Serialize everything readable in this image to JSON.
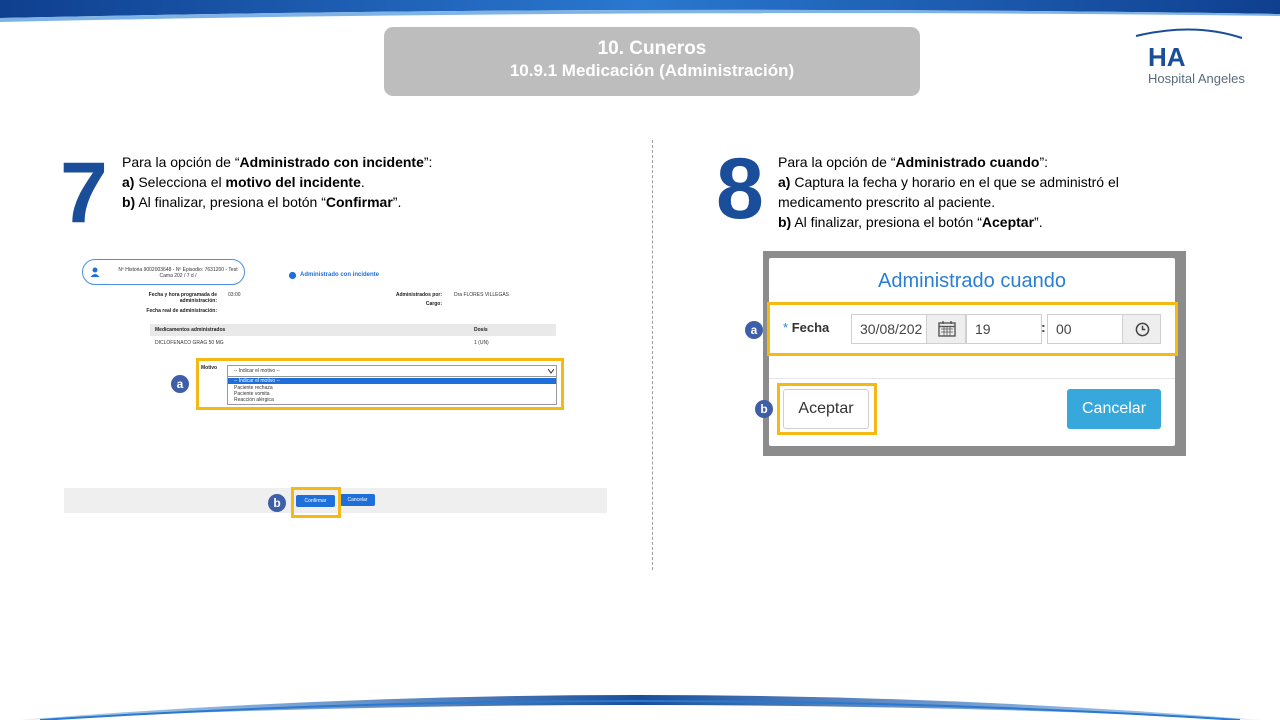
{
  "header": {
    "title_line1": "10. Cuneros",
    "title_line2": "10.9.1 Medicación (Administración)",
    "logo_text": "Hospital Angeles",
    "logo_mark": "HA"
  },
  "colors": {
    "brand_blue": "#1a4e9a",
    "highlight": "#f5b914",
    "badge": "#3e5ea9",
    "modal_title": "#2a7fd4",
    "cancel_btn": "#36a8dc"
  },
  "step7": {
    "number": "7",
    "line1_pre": "Para la opción de “",
    "line1_bold": "Administrado con incidente",
    "line1_post": "”:",
    "line2_bold_a": "a)",
    "line2_pre": " Selecciona el ",
    "line2_bold": "motivo del incidente",
    "line2_post": ".",
    "line3_bold_b": "b)",
    "line3_pre": " Al finalizar, presiona el botón “",
    "line3_bold": "Confirmar",
    "line3_post": "”.",
    "mock": {
      "patient_line1": "Nº Historia 9002003648 - Nº Episodio: 7631200 - Test",
      "patient_line2": "Cama 202 / 7 d /",
      "header_label": "Administrado con incidente",
      "sched_label": "Fecha y hora programada de administración:",
      "sched_value": "03:00",
      "real_label": "Fecha real de administración:",
      "admin_label": "Administrados por:",
      "admin_value": "Dra FLORES VILLEGAS",
      "cargo_label": "Cargo:",
      "col_meds": "Medicamentos administrados",
      "col_dose": "Dosis",
      "med_name": "DICLOFENACO GRAG 50 MG",
      "med_dose": "1 (UN)",
      "motivo_label": "Motivo",
      "select_value": "-- Indicar el motivo --",
      "options": [
        "-- Indicar el motivo --",
        "Paciente rechaza",
        "Paciente vomita",
        "Reacción alérgica"
      ],
      "confirm_btn": "Confirmar",
      "cancel_btn": "Cancelar",
      "badge_a": "a",
      "badge_b": "b"
    }
  },
  "step8": {
    "number": "8",
    "line1_pre": "Para la opción de “",
    "line1_bold": "Administrado cuando",
    "line1_post": "”:",
    "line2_bold_a": "a)",
    "line2_text": " Captura la fecha y horario en el que se administró el",
    "line3_text": "medicamento prescrito al paciente.",
    "line4_bold_b": "b)",
    "line4_pre": " Al finalizar, presiona el botón “",
    "line4_bold": "Aceptar",
    "line4_post": "”.",
    "modal": {
      "title": "Administrado cuando",
      "required_mark": "*",
      "fecha_label": "Fecha",
      "date_value": "30/08/202",
      "hour_value": "19",
      "time_sep": ":",
      "minute_value": "00",
      "accept_btn": "Aceptar",
      "cancel_btn": "Cancelar",
      "badge_a": "a",
      "badge_b": "b"
    }
  }
}
